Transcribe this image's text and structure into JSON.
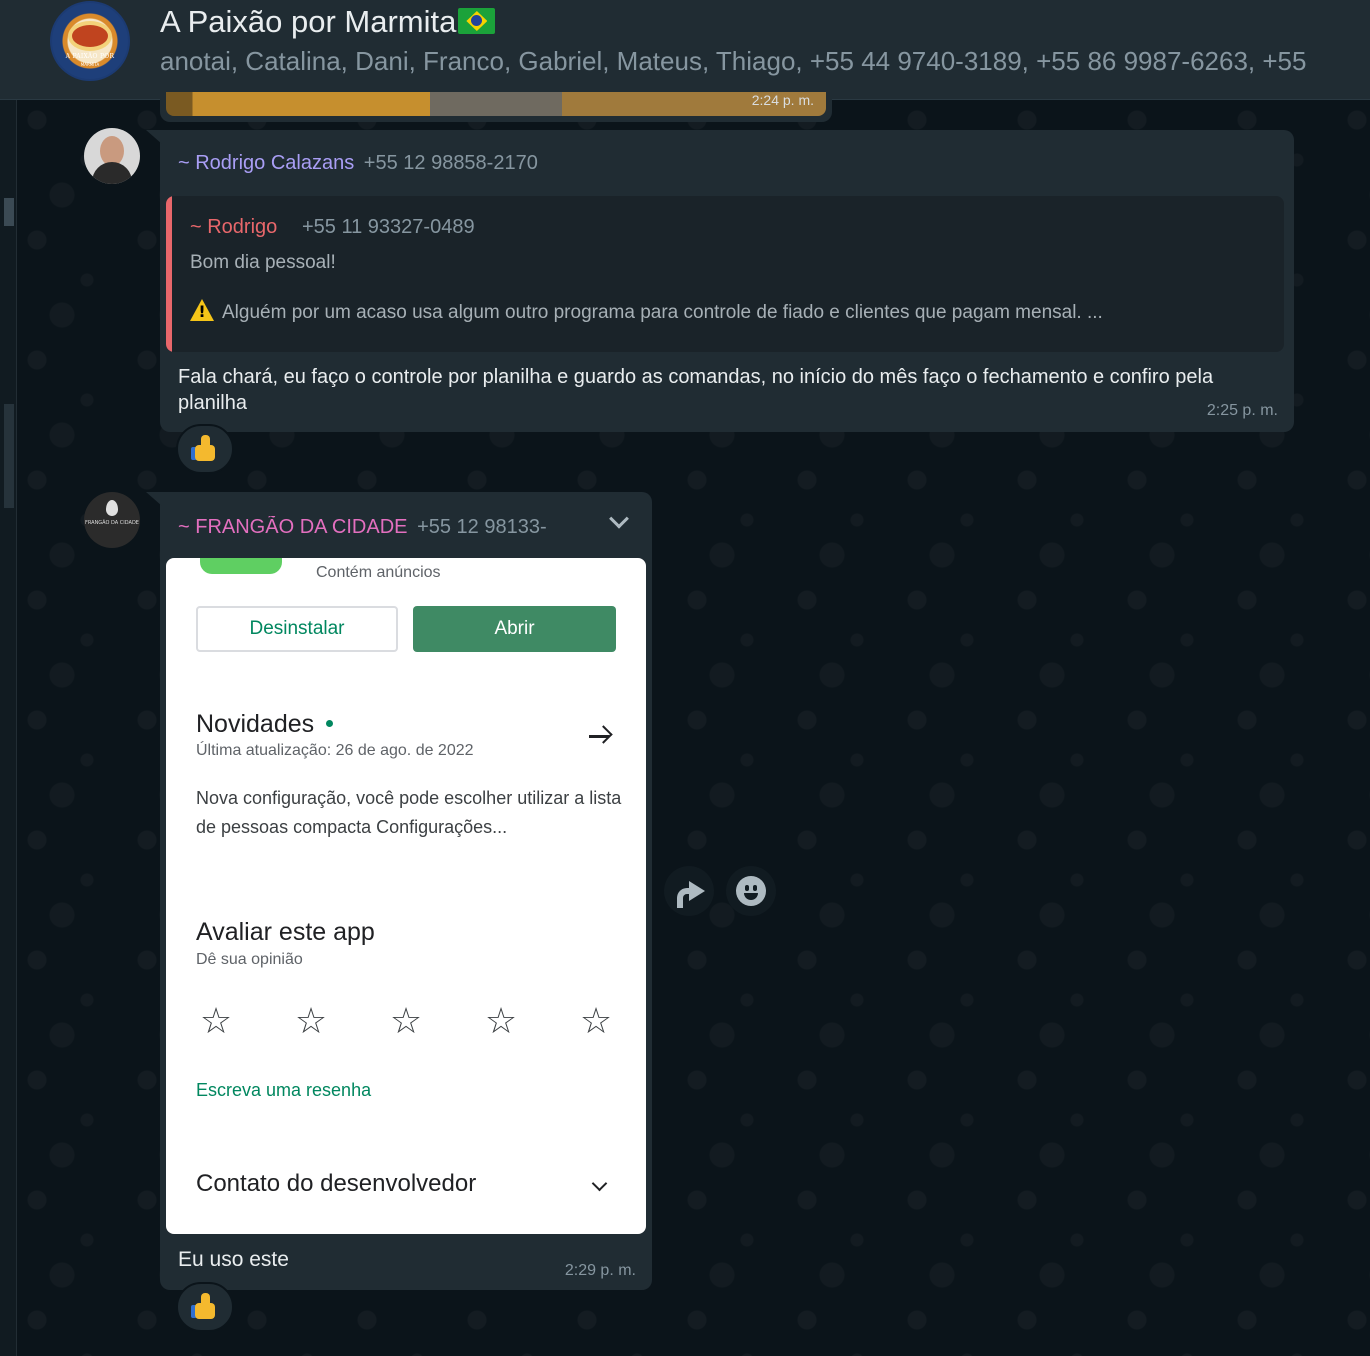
{
  "header": {
    "group_name": "A Paixão por Marmita",
    "participants": "anotai, Catalina, Dani, Franco, Gabriel, Mateus, Thiago, +55 44 9740-3189, +55 86 9987-6263, +55",
    "avatar_text": "A PAIXÃO POR",
    "avatar_subtext": "MARMITA"
  },
  "messages": [
    {
      "sender_name": "~ Rodrigo Calazans",
      "sender_phone": "+55 12 98858-2170",
      "quoted": {
        "name": "~ Rodrigo",
        "phone": "+55 11 93327-0489",
        "line1": "Bom dia pessoal!",
        "line2": "Alguém por um acaso usa algum outro programa para controle de fiado e clientes que pagam mensal.  ..."
      },
      "text": "Fala chará, eu faço o controle por planilha e guardo as comandas, no início do mês faço o fechamento e confiro pela planilha",
      "time": "2:25 p. m.",
      "reaction": "thumbs-up"
    },
    {
      "sender_name": "~ FRANGÃO DA CIDADE",
      "sender_phone": "+55 12 98133-",
      "avatar_text": "FRANGÃO DA CIDADE",
      "screenshot": {
        "ads_label": "Contém anúncios",
        "uninstall_label": "Desinstalar",
        "open_label": "Abrir",
        "news_title": "Novidades",
        "news_updated": "Última atualização: 26 de ago. de 2022",
        "news_body": "Nova configuração, você pode escolher utilizar a lista de pessoas compacta Configurações...",
        "rate_title": "Avaliar este app",
        "rate_sub": "Dê sua opinião",
        "star_glyph": "☆",
        "review_link": "Escreva uma resenha",
        "dev_contact": "Contato do desenvolvedor"
      },
      "text": "Eu uso este",
      "time": "2:29 p. m.",
      "reaction": "thumbs-up"
    }
  ],
  "colors": {
    "accent_green": "#01875f",
    "sender1": "#a99ef5",
    "sender2": "#e36fbf",
    "quote_accent": "#e8676b"
  }
}
